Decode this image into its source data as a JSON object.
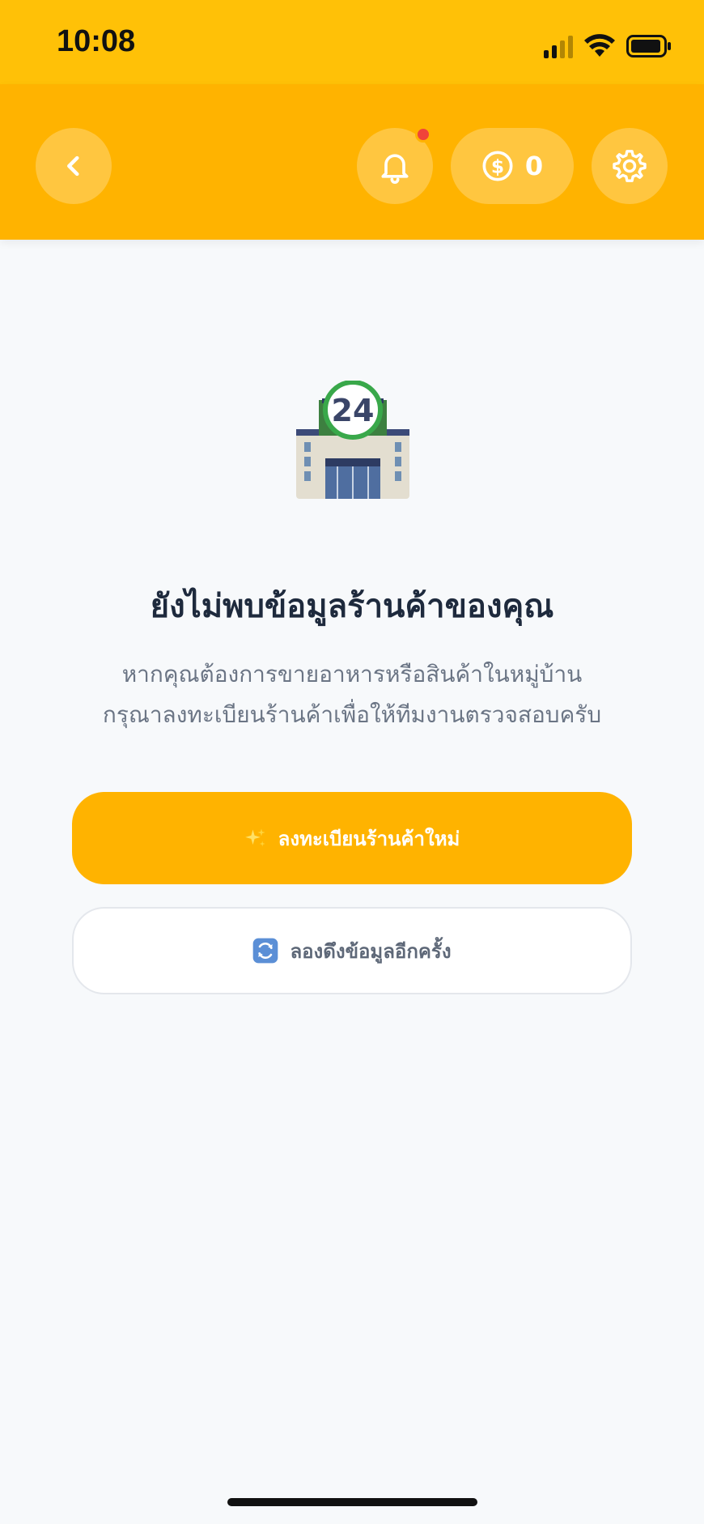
{
  "status_bar": {
    "time": "10:08"
  },
  "header": {
    "coin_count": "0",
    "colors": {
      "header": "#ffb300",
      "status_bar": "#ffc107",
      "notification_dot": "#f0443a"
    },
    "icons": [
      "chevron-left-icon",
      "bell-icon",
      "dollar-coin-icon",
      "gear-icon"
    ]
  },
  "empty_state": {
    "icon": "convenience-store-24-icon",
    "icon_badge": "24",
    "title": "ยังไม่พบข้อมูลร้านค้าของคุณ",
    "description_line1": "หากคุณต้องการขายอาหารหรือสินค้าในหมู่บ้าน",
    "description_line2": "กรุณาลงทะเบียนร้านค้าเพื่อให้ทีมงานตรวจสอบครับ"
  },
  "actions": {
    "register_label": "ลงทะเบียนร้านค้าใหม่",
    "retry_label": "ลองดึงข้อมูลอีกครั้ง"
  }
}
